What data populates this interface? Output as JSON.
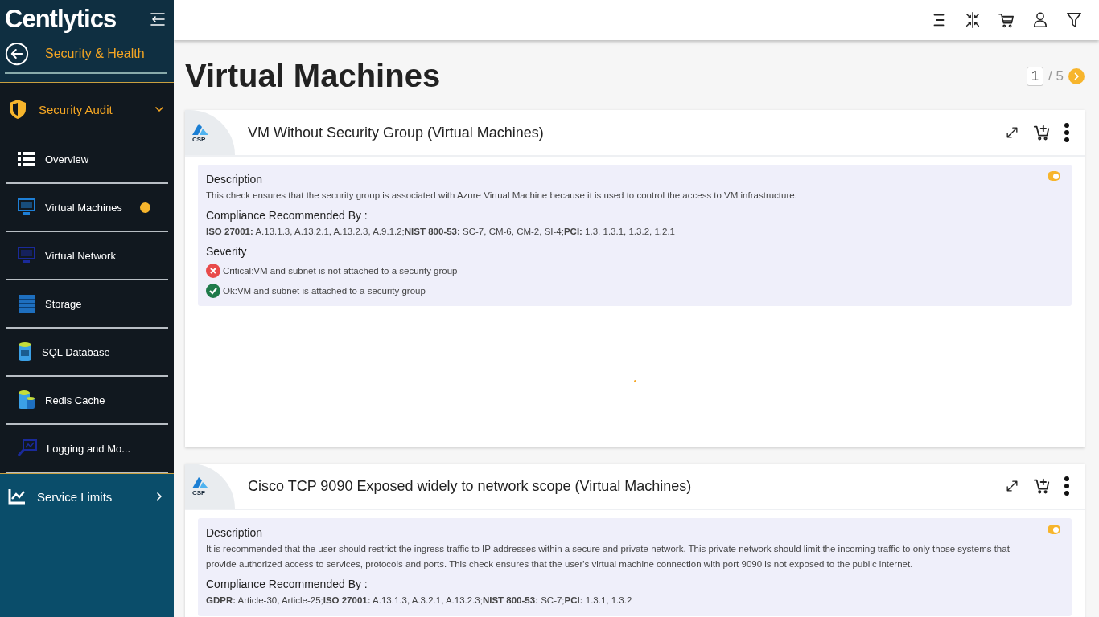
{
  "sidebar": {
    "logo": "Centlytics",
    "section_title": "Security & Health",
    "groups": [
      {
        "label": "Security Audit",
        "expanded": true,
        "items": [
          {
            "label": "Overview",
            "selected": false
          },
          {
            "label": "Virtual Machines",
            "selected": true
          },
          {
            "label": "Virtual Network",
            "selected": false
          },
          {
            "label": "Storage",
            "selected": false
          },
          {
            "label": "SQL Database",
            "selected": false
          },
          {
            "label": "Redis Cache",
            "selected": false
          },
          {
            "label": "Logging and Mo...",
            "selected": false
          }
        ]
      },
      {
        "label": "Service Limits",
        "expanded": false
      }
    ]
  },
  "page": {
    "title": "Virtual Machines",
    "pagination": {
      "current": "1",
      "total": "/ 5"
    }
  },
  "cards": [
    {
      "badge": "CSP",
      "title": "VM Without Security Group (Virtual Machines)",
      "toggle_on": true,
      "description_label": "Description",
      "description": "This check ensures that the security group is associated with Azure Virtual Machine because it is used to control the access to VM infrastructure.",
      "compliance_label": "Compliance Recommended By :",
      "compliance": "**ISO 27001:** A.13.1.3, A.13.2.1, A.13.2.3, A.9.1.2;**NIST 800-53:** SC-7, CM-6, CM-2, SI-4;**PCI:** 1.3, 1.3.1, 1.3.2, 1.2.1",
      "severity_label": "Severity",
      "severity": [
        {
          "kind": "critical",
          "text": "Critical:VM and subnet is not attached to a security group"
        },
        {
          "kind": "ok",
          "text": "Ok:VM and subnet is attached to a security group"
        }
      ]
    },
    {
      "badge": "CSP",
      "title": "Cisco TCP 9090 Exposed widely to network scope (Virtual Machines)",
      "toggle_on": true,
      "description_label": "Description",
      "description": "It is recommended that the user should restrict the ingress traffic to IP addresses within a secure and private network. This private network should limit the incoming traffic to only those systems that provide authorized access to services, protocols and ports. This check ensures that the user's virtual machine connection with port 9090 is not exposed to the public internet.",
      "compliance_label": "Compliance Recommended By :",
      "compliance": "**GDPR:** Article-30, Article-25;**ISO 27001:** A.13.1.3, A.3.2.1, A.13.2.3;**NIST 800-53:** SC-7;**PCI:** 1.3.1, 1.3.2"
    }
  ]
}
